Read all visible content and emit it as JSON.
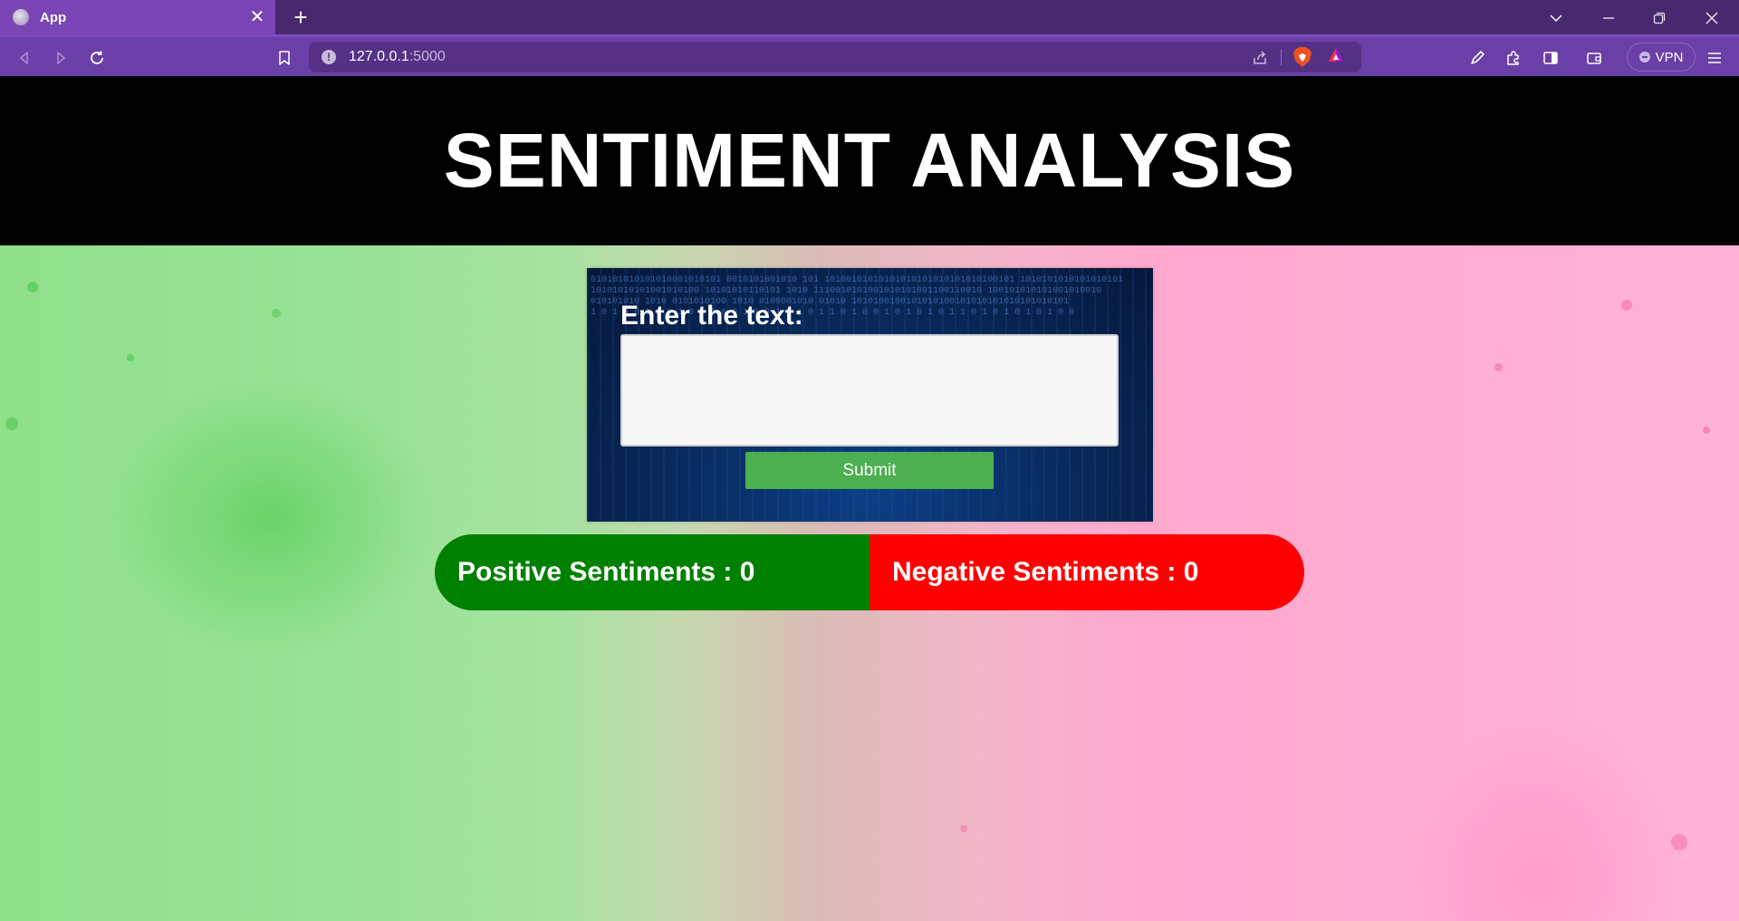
{
  "browser": {
    "tab_title": "App",
    "tab_close": "✕",
    "new_tab": "+",
    "url_host": "127.0.0.1",
    "url_port": ":5000",
    "vpn_label": "VPN",
    "icons": {
      "tab_list": "chevron-down-icon",
      "minimize": "minimize-icon",
      "restore": "restore-icon",
      "close": "close-icon",
      "back": "back-icon",
      "forward": "forward-icon",
      "reload": "reload-icon",
      "bookmark": "bookmark-icon",
      "site_info": "info-icon",
      "share": "share-icon",
      "brave_shields": "brave-lion-icon",
      "brave_rewards": "rewards-triangle-icon",
      "pen": "pen-icon",
      "extensions": "puzzle-icon",
      "sidebar": "sidebar-icon",
      "wallet": "wallet-icon",
      "menu": "hamburger-menu-icon"
    }
  },
  "page": {
    "title": "SENTIMENT ANALYSIS",
    "form": {
      "label": "Enter the text:",
      "textarea_value": "",
      "submit_label": "Submit"
    },
    "results": {
      "positive_label": "Positive Sentiments : 0",
      "negative_label": "Negative Sentiments : 0"
    }
  },
  "colors": {
    "header_bg": "#000000",
    "submit_bg": "#4caf50",
    "positive_bg": "#008000",
    "negative_bg": "#ff0000",
    "browser_tabbar": "#48296f",
    "browser_toolbar": "#6b3fa8"
  }
}
